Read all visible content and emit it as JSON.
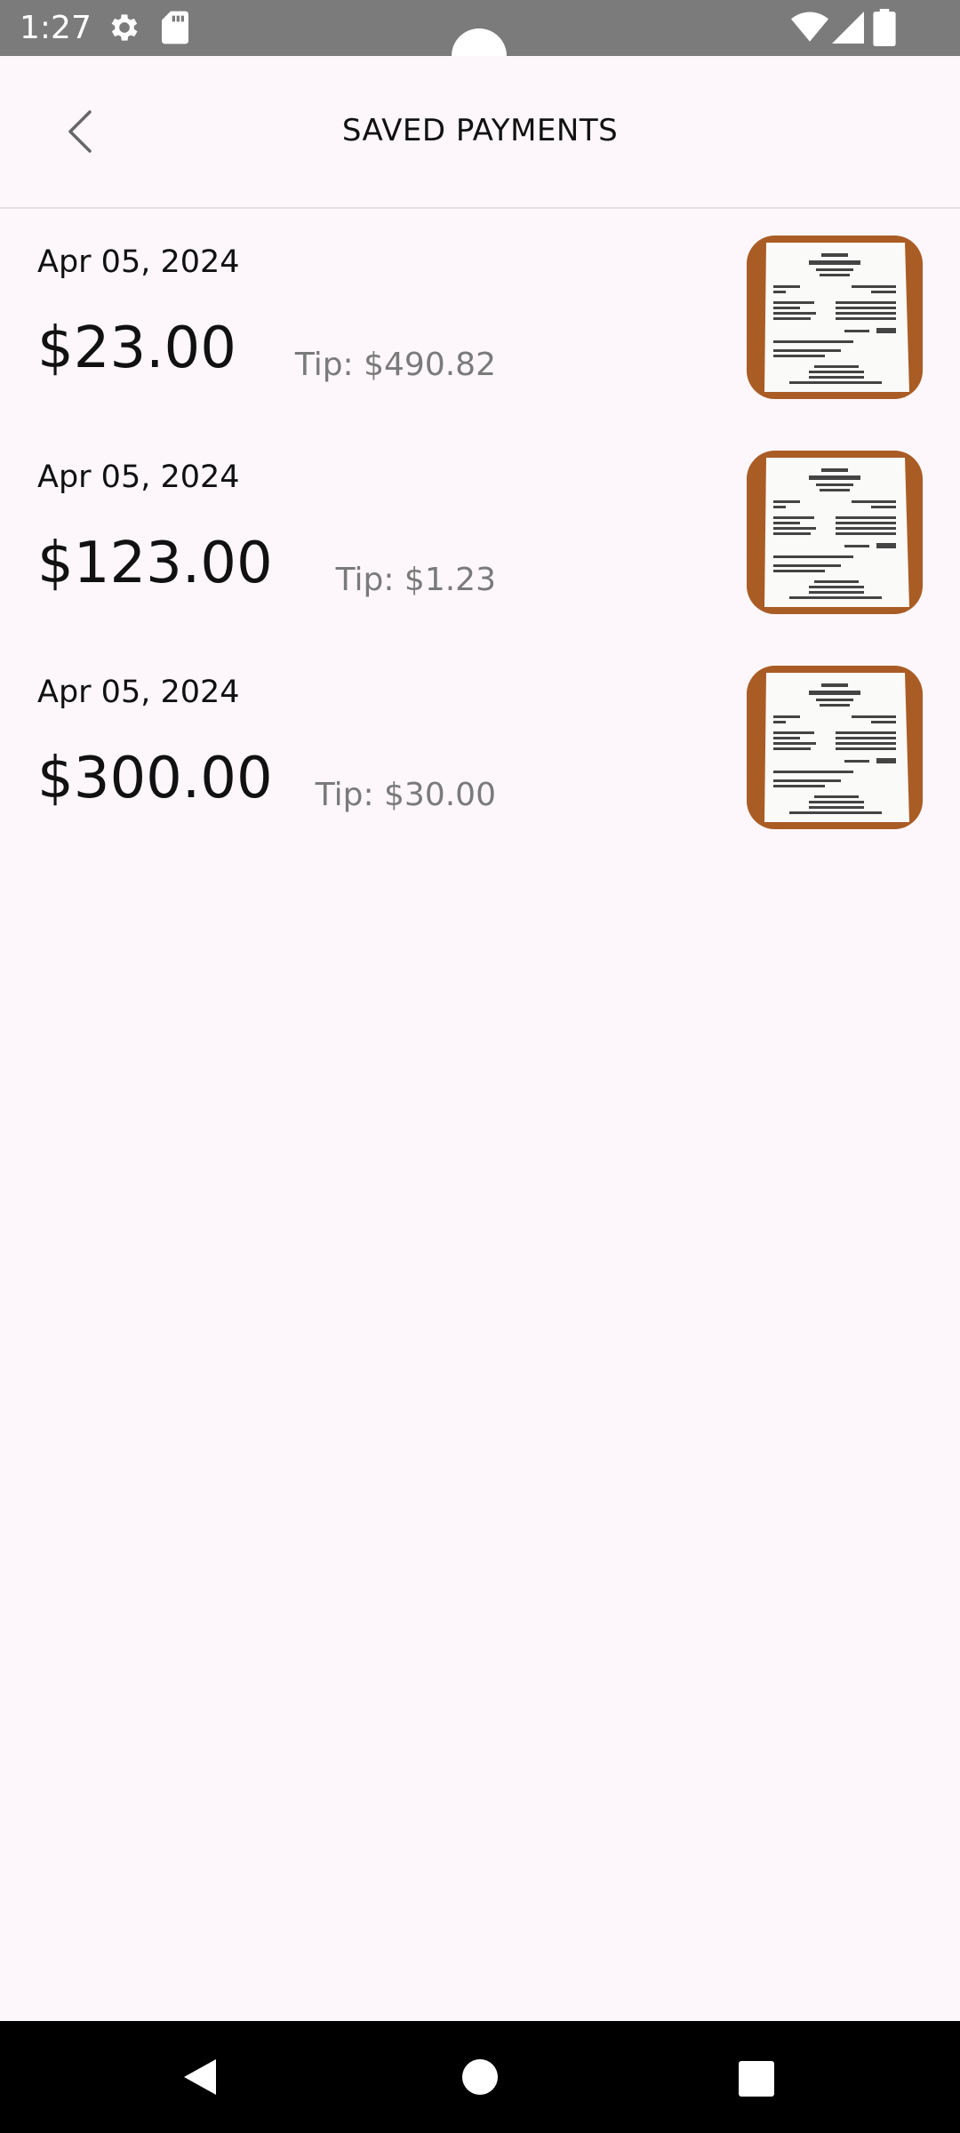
{
  "status_bar": {
    "time": "1:27",
    "icons": [
      "gear-icon",
      "sd-card-icon",
      "wifi-icon",
      "signal-icon",
      "battery-icon"
    ]
  },
  "header": {
    "title": "SAVED PAYMENTS",
    "back_icon": "chevron-left-icon"
  },
  "payments": [
    {
      "date": "Apr 05, 2024",
      "amount": "$23.00",
      "tip": "Tip: $490.82"
    },
    {
      "date": "Apr 05, 2024",
      "amount": "$123.00",
      "tip": "Tip: $1.23"
    },
    {
      "date": "Apr 05, 2024",
      "amount": "$300.00",
      "tip": "Tip: $30.00"
    }
  ],
  "colors": {
    "status_bar": "#7B7B7B",
    "background": "#FDF7FB",
    "tip_text": "#7A7A7A",
    "thumb_wood": "#B5652A"
  },
  "nav_bar": {
    "icons": [
      "nav-back-icon",
      "nav-home-icon",
      "nav-recents-icon"
    ]
  }
}
